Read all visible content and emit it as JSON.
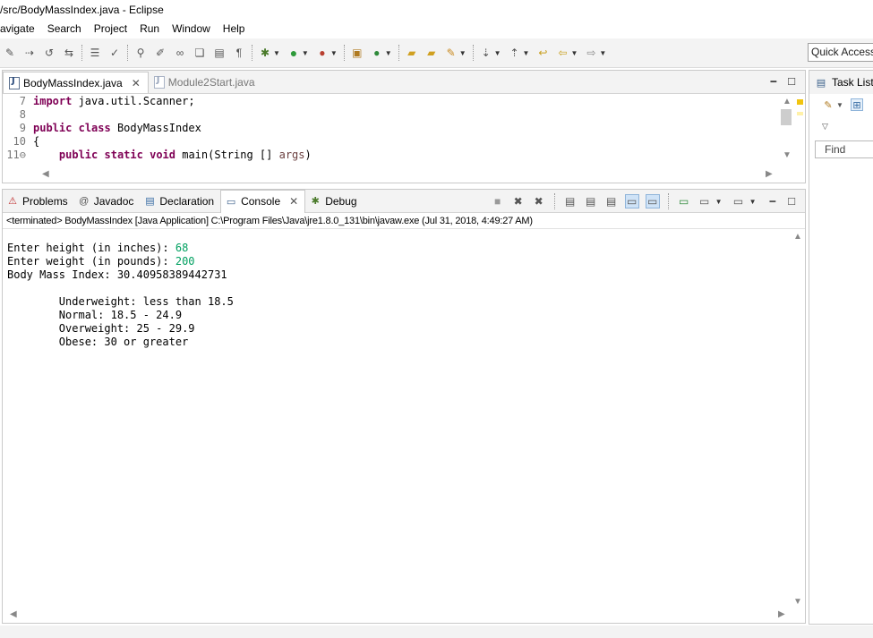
{
  "window": {
    "title": "/src/BodyMassIndex.java - Eclipse"
  },
  "menu": [
    "avigate",
    "Search",
    "Project",
    "Run",
    "Window",
    "Help"
  ],
  "quick_access": {
    "placeholder": "Quick Access"
  },
  "editor": {
    "tabs": [
      {
        "label": "BodyMassIndex.java",
        "active": true
      },
      {
        "label": "Module2Start.java",
        "active": false
      }
    ],
    "lines": [
      {
        "num": "7",
        "parts": [
          {
            "t": "import",
            "k": "kw"
          },
          {
            "t": " java.util.Scanner;"
          }
        ]
      },
      {
        "num": "8",
        "parts": []
      },
      {
        "num": "9",
        "parts": [
          {
            "t": "public",
            "k": "kw"
          },
          {
            "t": " "
          },
          {
            "t": "class",
            "k": "kw"
          },
          {
            "t": " BodyMassIndex"
          }
        ]
      },
      {
        "num": "10",
        "parts": [
          {
            "t": "{"
          }
        ]
      },
      {
        "num": "11⊖",
        "parts": [
          {
            "t": "    "
          },
          {
            "t": "public",
            "k": "kw"
          },
          {
            "t": " "
          },
          {
            "t": "static",
            "k": "kw"
          },
          {
            "t": " "
          },
          {
            "t": "void",
            "k": "kw"
          },
          {
            "t": " main(String [] "
          },
          {
            "t": "args",
            "k": "param"
          },
          {
            "t": ")"
          }
        ]
      }
    ]
  },
  "console": {
    "tabs": [
      {
        "label": "Problems",
        "icon": "problems-icon"
      },
      {
        "label": "Javadoc",
        "icon": "javadoc-icon"
      },
      {
        "label": "Declaration",
        "icon": "declaration-icon"
      },
      {
        "label": "Console",
        "icon": "console-icon",
        "active": true
      },
      {
        "label": "Debug",
        "icon": "debug-icon"
      }
    ],
    "terminated_line": "<terminated> BodyMassIndex [Java Application] C:\\Program Files\\Java\\jre1.8.0_131\\bin\\javaw.exe (Jul 31, 2018, 4:49:27 AM)",
    "output": [
      {
        "text": "Enter height (in inches): ",
        "input": "68"
      },
      {
        "text": "Enter weight (in pounds): ",
        "input": "200"
      },
      {
        "text": "Body Mass Index: 30.40958389442731",
        "input": ""
      },
      {
        "text": "",
        "input": ""
      },
      {
        "text": "        Underweight: less than 18.5",
        "input": ""
      },
      {
        "text": "        Normal: 18.5 - 24.9",
        "input": ""
      },
      {
        "text": "        Overweight: 25 - 29.9",
        "input": ""
      },
      {
        "text": "        Obese: 30 or greater",
        "input": ""
      }
    ]
  },
  "tasklist": {
    "title": "Task List",
    "find_label": "Find"
  },
  "colors": {
    "keyword": "#7f0055",
    "console_input": "#00a060",
    "line_number": "#787878"
  }
}
